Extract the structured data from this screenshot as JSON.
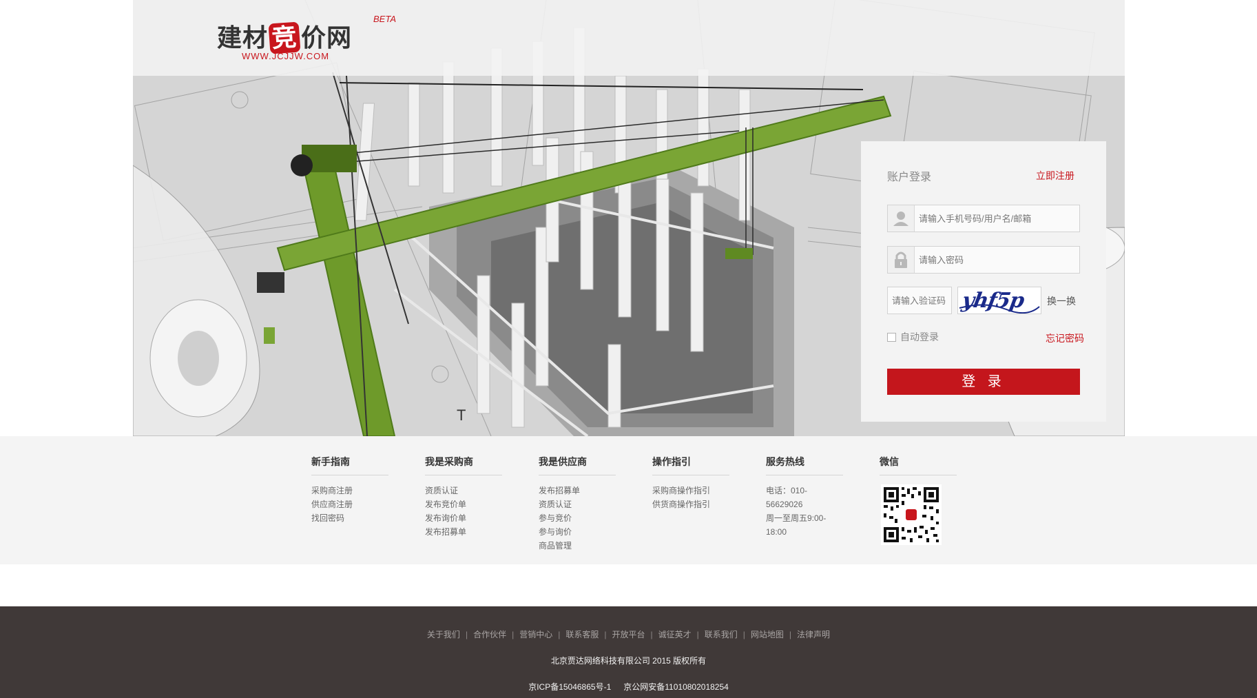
{
  "header": {
    "logo_text_a": "建材",
    "logo_text_mid": "竞",
    "logo_text_b": "价网",
    "logo_badge": "BETA",
    "logo_url": "WWW.JCJJW.COM"
  },
  "login": {
    "title": "账户登录",
    "register_link": "立即注册",
    "username_placeholder": "请输入手机号码/用户名/邮箱",
    "password_placeholder": "请输入密码",
    "captcha_placeholder": "请输入验证码",
    "captcha_text": "yhf5p",
    "captcha_refresh": "换一换",
    "auto_login": "自动登录",
    "forgot_password": "忘记密码",
    "submit": "登 录"
  },
  "footer_nav": {
    "columns": [
      {
        "title": "新手指南",
        "items": [
          "采购商注册",
          "供应商注册",
          "找回密码"
        ]
      },
      {
        "title": "我是采购商",
        "items": [
          "资质认证",
          "发布竞价单",
          "发布询价单",
          "发布招募单"
        ]
      },
      {
        "title": "我是供应商",
        "items": [
          "发布招募单",
          "资质认证",
          "参与竞价",
          "参与询价",
          "商品管理"
        ]
      },
      {
        "title": "操作指引",
        "items": [
          "采购商操作指引",
          "供货商操作指引"
        ]
      },
      {
        "title": "服务热线",
        "items": [
          "电话：010-56629026",
          "周一至周五9:00-18:00"
        ]
      },
      {
        "title": "微信",
        "items": []
      }
    ]
  },
  "bottom": {
    "links": [
      "关于我们",
      "合作伙伴",
      "营销中心",
      "联系客服",
      "开放平台",
      "诚征英才",
      "联系我们",
      "网站地图",
      "法律声明"
    ],
    "separator": "|",
    "copyright": "北京贾达网络科技有限公司 2015 版权所有",
    "icp": "京ICP备15046865号-1",
    "police": "京公网安备11010802018254"
  },
  "colors": {
    "brand_red": "#c8161d",
    "footer_dark": "#403938",
    "footer_light": "#f4f4f4",
    "crane_green": "#6a9a2a"
  },
  "icons": [
    "user-icon",
    "lock-icon",
    "wechat-qr-code"
  ]
}
